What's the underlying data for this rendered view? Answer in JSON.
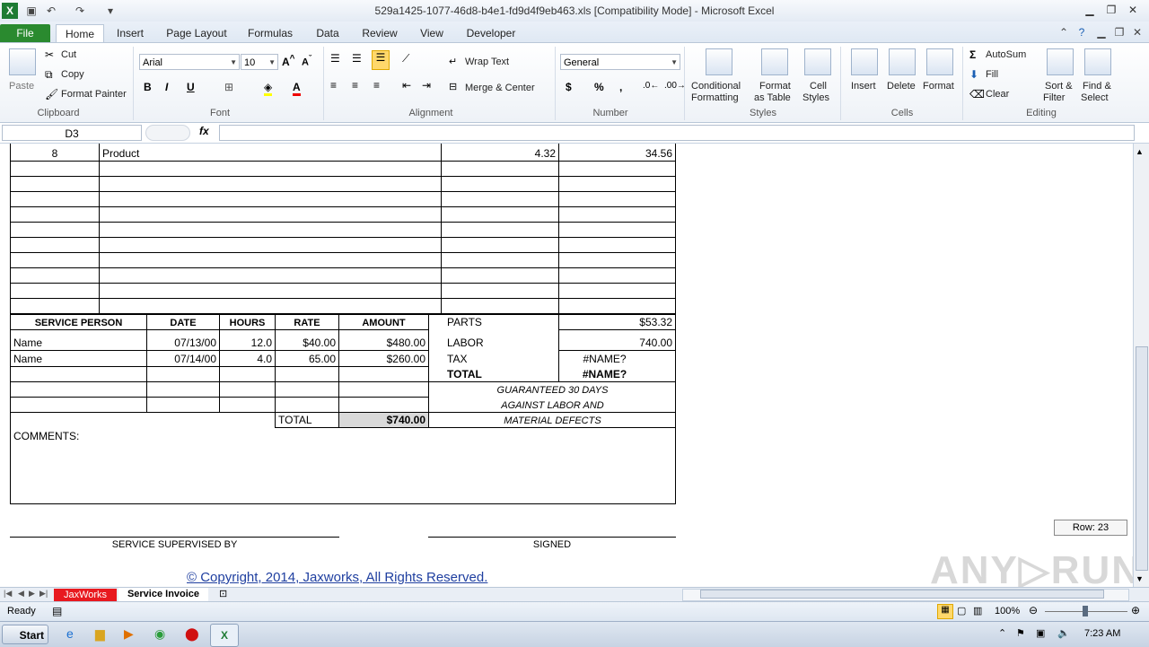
{
  "window": {
    "title": "529a1425-1077-46d8-b4e1-fd9d4f9eb463.xls  [Compatibility Mode]  -  Microsoft Excel"
  },
  "tabs": [
    "File",
    "Home",
    "Insert",
    "Page Layout",
    "Formulas",
    "Data",
    "Review",
    "View",
    "Developer"
  ],
  "ribbon": {
    "clipboard": {
      "paste": "Paste",
      "cut": "Cut",
      "copy": "Copy",
      "format_painter": "Format Painter",
      "label": "Clipboard"
    },
    "font": {
      "name": "Arial",
      "size": "10",
      "label": "Font",
      "bold": "B",
      "italic": "I",
      "underline": "U"
    },
    "alignment": {
      "wrap": "Wrap Text",
      "merge": "Merge & Center",
      "label": "Alignment"
    },
    "number": {
      "format": "General",
      "currency": "$",
      "percent": "%",
      "comma": ",",
      "label": "Number"
    },
    "styles": {
      "conditional": "Conditional",
      "conditional2": "Formatting",
      "format_table": "Format",
      "format_table2": "as Table",
      "cell_styles": "Cell",
      "cell_styles2": "Styles",
      "label": "Styles"
    },
    "cells": {
      "insert": "Insert",
      "delete": "Delete",
      "format": "Format",
      "label": "Cells"
    },
    "editing": {
      "autosum": "AutoSum",
      "fill": "Fill",
      "clear": "Clear",
      "sort": "Sort &",
      "sort2": "Filter",
      "find": "Find &",
      "find2": "Select",
      "label": "Editing"
    }
  },
  "formula_bar": {
    "name_box": "D3",
    "fx": "fx",
    "value": ""
  },
  "sheet": {
    "product_row": {
      "qty": "8",
      "desc": "Product",
      "price": "4.32",
      "amount": "34.56"
    },
    "service_headers": [
      "SERVICE PERSON",
      "DATE",
      "HOURS",
      "RATE",
      "AMOUNT"
    ],
    "service_rows": [
      {
        "person": "Name",
        "date": "07/13/00",
        "hours": "12.0",
        "rate": "$40.00",
        "amount": "$480.00"
      },
      {
        "person": "Name",
        "date": "07/14/00",
        "hours": "4.0",
        "rate": "65.00",
        "amount": "$260.00"
      }
    ],
    "service_total_label": "TOTAL",
    "service_total": "$740.00",
    "summary": [
      {
        "label": "PARTS",
        "value": "$53.32"
      },
      {
        "label": "LABOR",
        "value": "740.00"
      },
      {
        "label": "TAX",
        "value": "#NAME?"
      },
      {
        "label": "TOTAL",
        "value": "#NAME?"
      }
    ],
    "guarantee": [
      "GUARANTEED 30 DAYS",
      "AGAINST LABOR AND",
      "MATERIAL DEFECTS"
    ],
    "comments": "COMMENTS:",
    "supervised": "SERVICE SUPERVISED BY",
    "signed": "SIGNED",
    "copyright": "© Copyright, 2014, Jaxworks, All Rights Reserved.",
    "row_tip": "Row: 23"
  },
  "sheet_tabs": [
    "JaxWorks",
    "Service Invoice"
  ],
  "status": {
    "ready": "Ready",
    "zoom": "100%"
  },
  "taskbar": {
    "start": "Start",
    "time": "7:23 AM"
  },
  "colors": {
    "file_tab": "#2a8a2f",
    "jaxworks_tab": "#e8191f",
    "link": "#1f3fa0"
  }
}
